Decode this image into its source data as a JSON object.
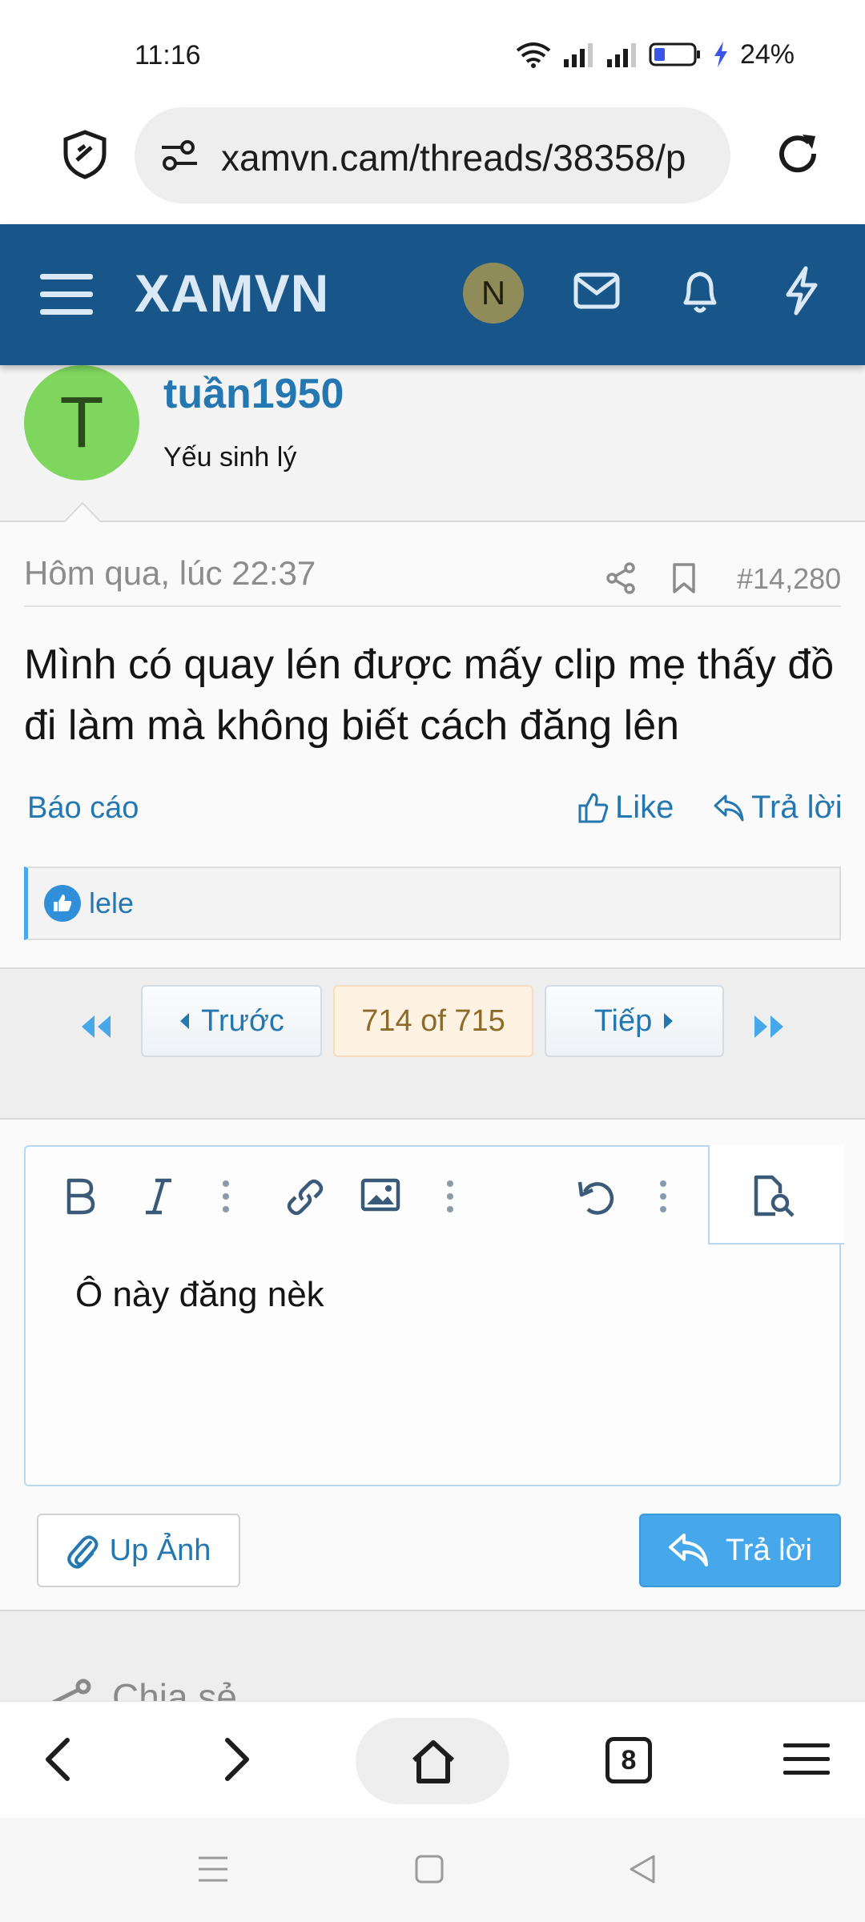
{
  "status_bar": {
    "time": "11:16",
    "battery": "24%"
  },
  "browser": {
    "url": "xamvn.cam/threads/38358/p",
    "tab_count": "8"
  },
  "site": {
    "logo": "XAMVN",
    "user_initial": "N"
  },
  "post": {
    "author_initial": "T",
    "author": "tuần1950",
    "author_title": "Yếu sinh lý",
    "date": "Hôm qua, lúc 22:37",
    "number": "#14,280",
    "content": "Mình có quay lén được mấy clip mẹ thấy đồ đi làm mà không biết cách đăng lên",
    "report": "Báo cáo",
    "like": "Like",
    "reply": "Trả lời",
    "reaction_user": "lele"
  },
  "pagination": {
    "prev": "Trước",
    "current": "714 of 715",
    "next": "Tiếp"
  },
  "editor": {
    "text": "Ô này đăng nèk",
    "upload": "Up Ảnh",
    "submit": "Trả lời"
  },
  "share": {
    "label": "Chia sẻ"
  },
  "colors": {
    "header": "#185689",
    "accent": "#2577b1",
    "button": "#47a7eb",
    "avatar_user": "#7fd65e",
    "avatar_n": "#8f8c5a"
  }
}
